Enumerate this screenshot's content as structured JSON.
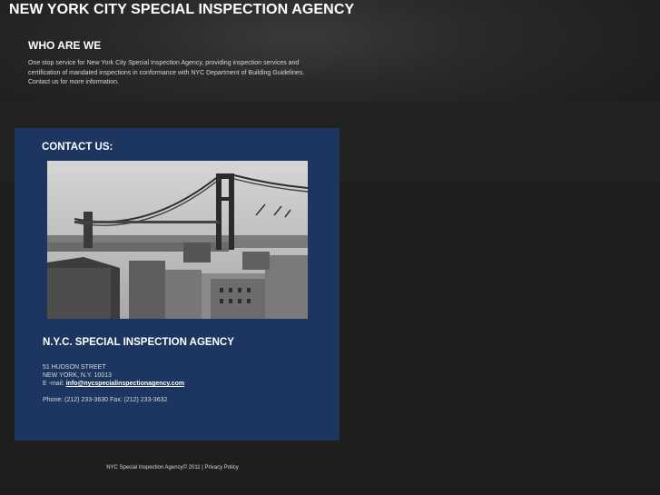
{
  "header": {
    "title": "NEW YORK CITY SPECIAL INSPECTION AGENCY"
  },
  "about": {
    "heading": "WHO ARE WE",
    "lines": [
      "One stop service for New York City Special Inspection Agency, providing inspection services and",
      "certification of mandated inspections in conformance with NYC Department of Building Guidelines.",
      "Contact us for more information."
    ]
  },
  "contact": {
    "heading": "CONTACT US:",
    "photo_icon": "bridge-photo",
    "agency_name": "N.Y.C. SPECIAL INSPECTION AGENCY",
    "address_line1": "51 HUDSON STREET",
    "address_line2": "NEW YORK, N.Y. 10013",
    "email_label": "E -mail:",
    "email": "info@nycspecialinspectionagency.com",
    "phone": "Phone: (212) 233-3630 Fax: (212) 233-3632"
  },
  "footer": {
    "copyright": "NYC Special Inspection Agency© 2011",
    "separator": "|",
    "privacy": "Privacy Policy"
  },
  "colors": {
    "panel": "#1c3660",
    "background": "#1d1d1d",
    "title": "#ffffff"
  }
}
